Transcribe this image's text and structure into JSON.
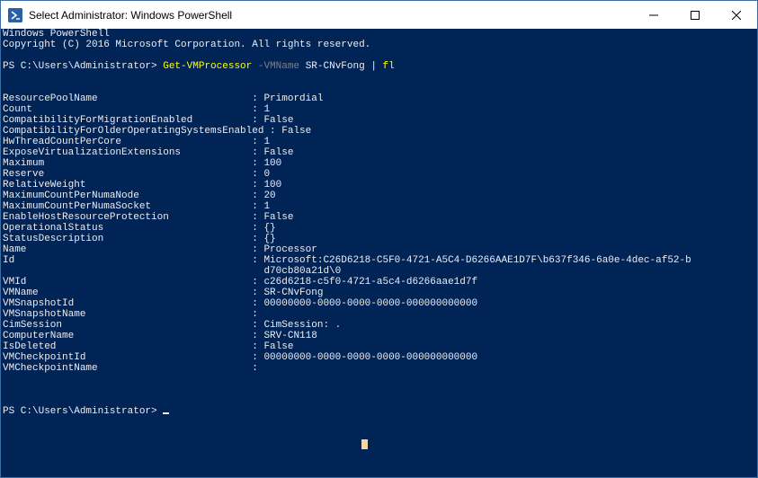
{
  "window": {
    "title": "Select Administrator: Windows PowerShell"
  },
  "icons": {
    "app": "powershell-icon",
    "minimize": "minimize-icon",
    "maximize": "maximize-icon",
    "close": "close-icon"
  },
  "colors": {
    "console_bg": "#012456",
    "text": "#eeedf0",
    "command": "#ffff00",
    "parameter": "#808080"
  },
  "console": {
    "header1": "Windows PowerShell",
    "header2": "Copyright (C) 2016 Microsoft Corporation. All rights reserved.",
    "prompt": "PS C:\\Users\\Administrator> ",
    "command": "Get-VMProcessor",
    "parameter": "-VMName",
    "argument": "SR-CNvFong",
    "pipe": "|",
    "pipe_command": "fl",
    "properties": [
      "ResourcePoolName                          : Primordial",
      "Count                                     : 1",
      "CompatibilityForMigrationEnabled          : False",
      "CompatibilityForOlderOperatingSystemsEnabled : False",
      "HwThreadCountPerCore                      : 1",
      "ExposeVirtualizationExtensions            : False",
      "Maximum                                   : 100",
      "Reserve                                   : 0",
      "RelativeWeight                            : 100",
      "MaximumCountPerNumaNode                   : 20",
      "MaximumCountPerNumaSocket                 : 1",
      "EnableHostResourceProtection              : False",
      "OperationalStatus                         : {}",
      "StatusDescription                         : {}",
      "Name                                      : Processor",
      "Id                                        : Microsoft:C26D6218-C5F0-4721-A5C4-D6266AAE1D7F\\b637f346-6a0e-4dec-af52-b",
      "                                            d70cb80a21d\\0",
      "VMId                                      : c26d6218-c5f0-4721-a5c4-d6266aae1d7f",
      "VMName                                    : SR-CNvFong",
      "VMSnapshotId                              : 00000000-0000-0000-0000-000000000000",
      "VMSnapshotName                            :",
      "CimSession                                : CimSession: .",
      "ComputerName                              : SRV-CN118",
      "IsDeleted                                 : False",
      "VMCheckpointId                            : 00000000-0000-0000-0000-000000000000",
      "VMCheckpointName                          :"
    ],
    "final_prompt": "PS C:\\Users\\Administrator> "
  }
}
